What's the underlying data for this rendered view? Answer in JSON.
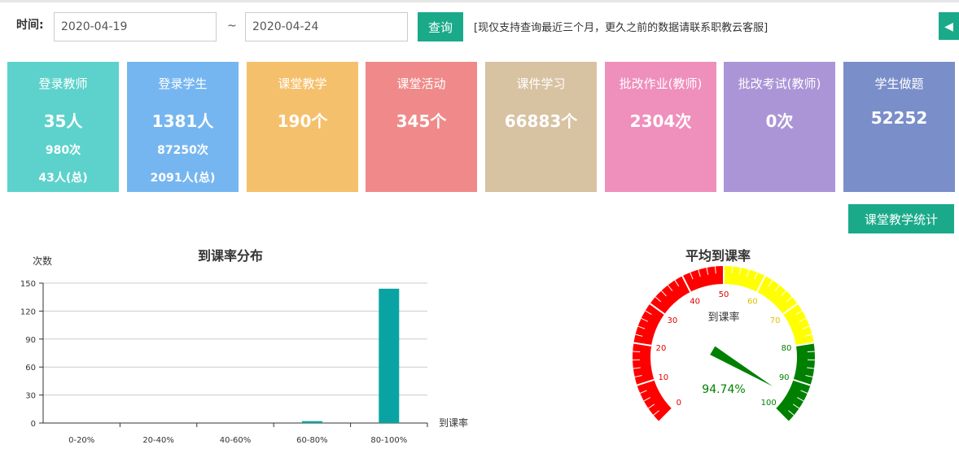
{
  "filter": {
    "time_label": "时间:",
    "start_date": "2020-04-19",
    "separator": "~",
    "end_date": "2020-04-24",
    "query_button": "查询",
    "note": "[现仅支持查询最近三个月，更久之前的数据请联系职教云客服]",
    "back_icon": "back-arrow-icon"
  },
  "cards": [
    {
      "title": "登录教师",
      "value": "35人",
      "sub1": "980次",
      "sub2": "43人(总)",
      "color": "#5dd2cc"
    },
    {
      "title": "登录学生",
      "value": "1381人",
      "sub1": "87250次",
      "sub2": "2091人(总)",
      "color": "#76b6f0"
    },
    {
      "title": "课堂教学",
      "value": "190个",
      "sub1": "",
      "sub2": "",
      "color": "#f5c06c"
    },
    {
      "title": "课堂活动",
      "value": "345个",
      "sub1": "",
      "sub2": "",
      "color": "#f08a8a"
    },
    {
      "title": "课件学习",
      "value": "66883个",
      "sub1": "",
      "sub2": "",
      "color": "#d7c2a2"
    },
    {
      "title": "批改作业(教师)",
      "value": "2304次",
      "sub1": "",
      "sub2": "",
      "color": "#ef8fbb"
    },
    {
      "title": "批改考试(教师)",
      "value": "0次",
      "sub1": "",
      "sub2": "",
      "color": "#ab95d6"
    },
    {
      "title": "学生做题",
      "value": "52252",
      "sub1": "",
      "sub2": "",
      "color": "#7a8ec9"
    }
  ],
  "stats_button": "课堂教学统计",
  "chart_data": [
    {
      "type": "bar",
      "title": "到课率分布",
      "ylabel": "次数",
      "xlabel": "到课率",
      "categories": [
        "0-20%",
        "20-40%",
        "40-60%",
        "60-80%",
        "80-100%"
      ],
      "values": [
        0,
        0,
        0,
        2,
        144
      ],
      "ylim": [
        0,
        150
      ],
      "yticks": [
        0,
        30,
        60,
        90,
        120,
        150
      ],
      "grid": true,
      "bar_color": "#0aa3a3"
    },
    {
      "type": "gauge",
      "title": "平均到课率",
      "center_label": "到课率",
      "value": 94.74,
      "value_label": "94.74%",
      "range": [
        0,
        100
      ],
      "ticks": [
        0,
        10,
        20,
        30,
        40,
        50,
        60,
        70,
        80,
        90,
        100
      ],
      "bands": [
        {
          "from": 0,
          "to": 50,
          "color": "#ff0000"
        },
        {
          "from": 50,
          "to": 80,
          "color": "#ffff00"
        },
        {
          "from": 80,
          "to": 100,
          "color": "#008000"
        }
      ],
      "pointer_color": "#008000"
    }
  ]
}
